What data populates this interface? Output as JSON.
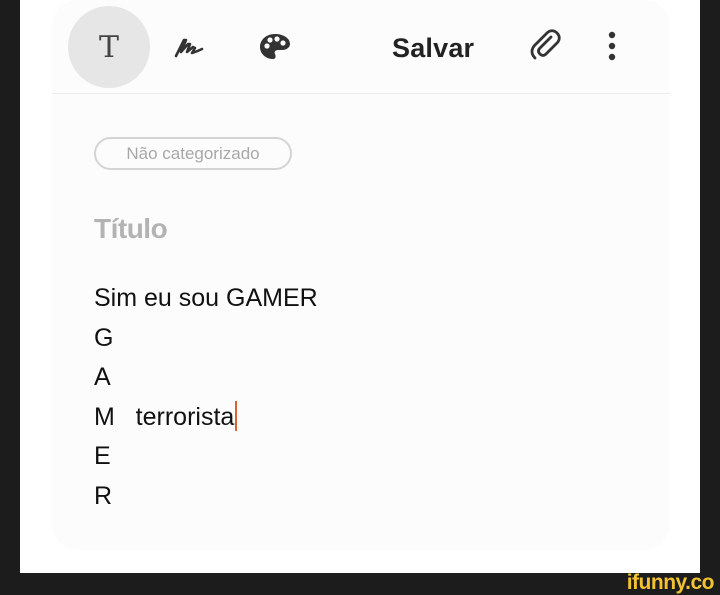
{
  "toolbar": {
    "text_tool_glyph": "T",
    "handwriting_icon": "handwriting-icon",
    "palette_icon": "palette-icon",
    "save_label": "Salvar",
    "attach_icon": "paperclip-icon",
    "more_icon": "more-vertical-icon"
  },
  "note": {
    "category_label": "Não categorizado",
    "title_placeholder": "Título",
    "body_lines": [
      "Sim eu sou GAMER",
      "G",
      "A",
      "M   terrorista",
      "E",
      "R"
    ]
  },
  "watermark": {
    "text": "ifunny.co"
  },
  "colors": {
    "background": "#1c1c1c",
    "card": "#fcfcfc",
    "cursor": "#e0602a",
    "watermark": "#f2c230"
  }
}
